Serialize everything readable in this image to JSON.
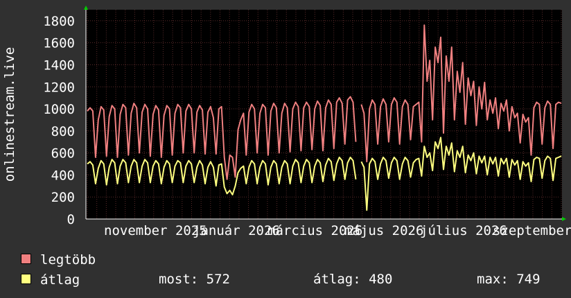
{
  "chart_data": {
    "type": "line",
    "ylabel": "onlinestream.live",
    "ylim": [
      0,
      1900
    ],
    "yticks": [
      0,
      200,
      400,
      600,
      800,
      1000,
      1200,
      1400,
      1600,
      1800
    ],
    "xtick_labels": [
      "november 2025",
      "január 2026",
      "március 2026",
      "május 2026",
      "július 2026",
      "szeptember"
    ],
    "grid": true,
    "series": [
      {
        "name": "legtöbb",
        "color": "#f08080",
        "values": [
          980,
          1010,
          980,
          560,
          900,
          1020,
          990,
          570,
          930,
          1030,
          1000,
          560,
          950,
          1040,
          1010,
          580,
          960,
          1050,
          1010,
          600,
          970,
          1040,
          1000,
          570,
          950,
          1030,
          990,
          560,
          940,
          1030,
          1000,
          580,
          960,
          1040,
          1010,
          600,
          980,
          1040,
          1000,
          600,
          970,
          1030,
          990,
          590,
          970,
          1020,
          920,
          590,
          1000,
          1020,
          560,
          360,
          580,
          560,
          380,
          810,
          900,
          960,
          580,
          970,
          1040,
          1000,
          600,
          960,
          1040,
          1010,
          580,
          980,
          1050,
          1010,
          600,
          960,
          1050,
          1010,
          610,
          1000,
          1060,
          1020,
          620,
          1010,
          1060,
          1020,
          630,
          1000,
          1070,
          1030,
          620,
          1010,
          1080,
          1040,
          640,
          1060,
          1100,
          1050,
          680,
          1080,
          1110,
          1060,
          700,
          null,
          1040,
          960,
          520,
          1000,
          1080,
          1040,
          680,
          1020,
          1090,
          1040,
          700,
          1040,
          1100,
          1060,
          680,
          1020,
          1080,
          1040,
          720,
          1020,
          1040,
          1060,
          700,
          1760,
          1250,
          1440,
          900,
          1560,
          1420,
          1650,
          780,
          1480,
          1250,
          1560,
          900,
          1340,
          1150,
          1420,
          860,
          1280,
          1120,
          1250,
          850,
          1200,
          1000,
          1240,
          900,
          1080,
          960,
          1100,
          820,
          1050,
          980,
          1080,
          800,
          1020,
          920,
          960,
          690,
          950,
          880,
          920,
          580,
          1010,
          1060,
          1040,
          680,
          1010,
          1070,
          1040,
          640,
          1040,
          1060,
          1050
        ],
        "last_points": 0
      },
      {
        "name": "átlag",
        "color": "#ffff80",
        "values": [
          500,
          520,
          490,
          320,
          460,
          530,
          500,
          310,
          470,
          540,
          510,
          320,
          480,
          540,
          510,
          330,
          480,
          540,
          510,
          330,
          480,
          540,
          510,
          330,
          480,
          530,
          500,
          320,
          470,
          530,
          500,
          330,
          480,
          530,
          510,
          330,
          480,
          530,
          500,
          330,
          470,
          530,
          490,
          320,
          470,
          520,
          470,
          300,
          490,
          500,
          290,
          230,
          260,
          220,
          300,
          420,
          460,
          480,
          320,
          470,
          530,
          500,
          320,
          470,
          530,
          500,
          310,
          470,
          530,
          500,
          320,
          470,
          530,
          500,
          320,
          480,
          540,
          510,
          330,
          480,
          540,
          510,
          330,
          480,
          540,
          510,
          340,
          490,
          550,
          520,
          350,
          500,
          560,
          530,
          360,
          510,
          560,
          530,
          360,
          null,
          520,
          470,
          80,
          500,
          550,
          520,
          360,
          500,
          560,
          530,
          370,
          510,
          560,
          530,
          360,
          500,
          560,
          530,
          380,
          510,
          540,
          550,
          390,
          660,
          560,
          600,
          440,
          700,
          640,
          740,
          450,
          660,
          580,
          690,
          430,
          620,
          560,
          660,
          420,
          580,
          530,
          600,
          410,
          570,
          510,
          570,
          400,
          560,
          500,
          560,
          390,
          550,
          500,
          550,
          380,
          540,
          490,
          530,
          360,
          520,
          480,
          510,
          340,
          540,
          560,
          550,
          370,
          530,
          570,
          550,
          350,
          550,
          560,
          572
        ],
        "last_points": 0
      }
    ],
    "stats": {
      "most_label": "most: 572",
      "atlag_label": "átlag: 480",
      "max_label": "max: 749"
    }
  },
  "legend": {
    "legtobb": "legtöbb",
    "atlag": "átlag"
  },
  "colors": {
    "background": "#303030",
    "plot_background": "#000000",
    "grid": "#5a2a2a",
    "axis_arrow": "#00cc00"
  }
}
